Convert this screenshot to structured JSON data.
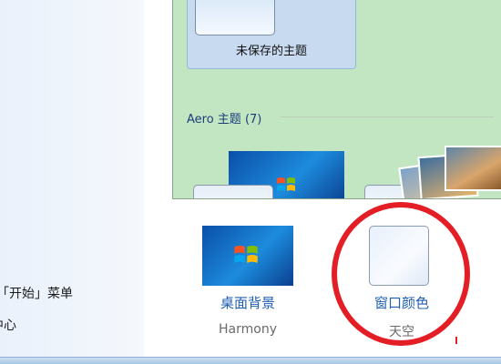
{
  "left_pane": {
    "link_start_menu": "「开始」菜单",
    "link_center": "中心"
  },
  "gallery": {
    "selected_theme_label": "未保存的主题",
    "section_header": "Aero 主题 (7)"
  },
  "bottom_items": {
    "desktop_background": {
      "title": "桌面背景",
      "subtitle": "Harmony"
    },
    "window_color": {
      "title": "窗口颜色",
      "subtitle": "天空"
    }
  },
  "colors": {
    "gallery_bg": "#c2e6c2",
    "link_blue": "#1f5fb0",
    "annotation_red": "#e31e24"
  }
}
